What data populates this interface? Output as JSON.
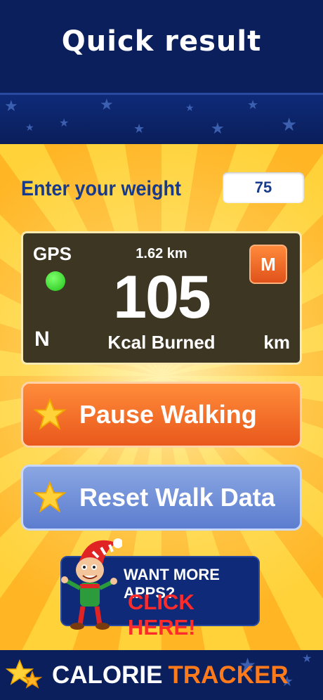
{
  "header": {
    "title": "Quick result"
  },
  "weight": {
    "label": "Enter your weight",
    "value": "75"
  },
  "tracker": {
    "gps_label": "GPS",
    "gps_status_color": "#22c21a",
    "direction": "N",
    "distance": "1.62 km",
    "kcal_value": "105",
    "kcal_label": "Kcal Burned",
    "unit": "km",
    "mode_button": "M"
  },
  "buttons": {
    "pause": "Pause Walking",
    "reset": "Reset Walk Data"
  },
  "ad": {
    "line1": "WANT MORE APPS?",
    "line2": "CLICK HERE!"
  },
  "footer": {
    "logo_part1": "CALORIE",
    "logo_part2": "TRACKER"
  },
  "colors": {
    "accent_orange": "#e9581c",
    "accent_blue": "#5c7dcf",
    "header_navy": "#0b1f5c"
  }
}
